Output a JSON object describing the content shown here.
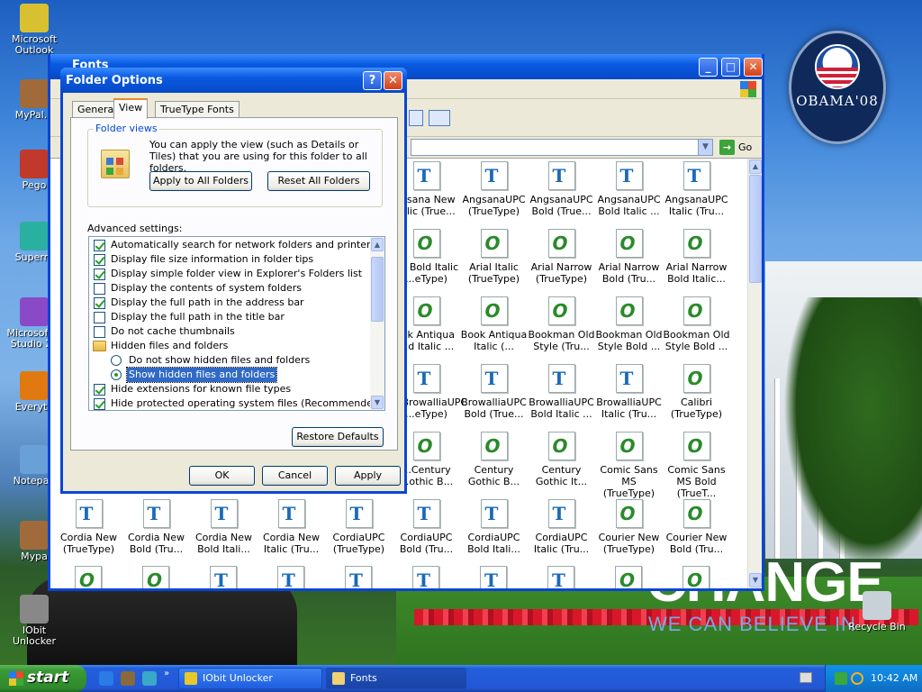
{
  "desktop": {
    "icons": [
      {
        "label": "Microsoft Outlook",
        "color": "#d8c030"
      },
      {
        "label": "MyPal...",
        "color": "#a06a3a"
      },
      {
        "label": "Pego",
        "color": "#c0392b"
      },
      {
        "label": "Superm",
        "color": "#2ab0a0"
      },
      {
        "label": "Microsoft V Studio 20",
        "color": "#8a4ac8"
      },
      {
        "label": "Everyth",
        "color": "#e07a10"
      },
      {
        "label": "Notepad",
        "color": "#6aa0d8"
      },
      {
        "label": "Mypa",
        "color": "#a06a3a"
      },
      {
        "label": "IObit Unlocker",
        "color": "#888888"
      },
      {
        "label": "Recycle Bin",
        "color": "#c8d0d8"
      }
    ],
    "wallpaper": {
      "logo_text": "OBAMA'08",
      "headline": "CHANGE",
      "tagline": "WE CAN BELIEVE IN"
    }
  },
  "fonts_window": {
    "title": "Fonts",
    "go_label": "Go",
    "items": [
      {
        "label": "...sana New ...lic (True...",
        "icon": "tt"
      },
      {
        "label": "AngsanaUPC (TrueType)",
        "icon": "tt"
      },
      {
        "label": "AngsanaUPC Bold (True...",
        "icon": "tt"
      },
      {
        "label": "AngsanaUPC Bold Italic ...",
        "icon": "tt"
      },
      {
        "label": "AngsanaUPC Italic (Tru...",
        "icon": "tt"
      },
      {
        "label": "...l Bold Italic ...eType)",
        "icon": "op"
      },
      {
        "label": "Arial Italic (TrueType)",
        "icon": "op"
      },
      {
        "label": "Arial Narrow (TrueType)",
        "icon": "op"
      },
      {
        "label": "Arial Narrow Bold (Tru...",
        "icon": "op"
      },
      {
        "label": "Arial Narrow Bold Italic...",
        "icon": "op"
      },
      {
        "label": "...k Antiqua ...d Italic ...",
        "icon": "op"
      },
      {
        "label": "Book Antiqua Italic (...",
        "icon": "op"
      },
      {
        "label": "Bookman Old Style (Tru...",
        "icon": "op"
      },
      {
        "label": "Bookman Old Style Bold ...",
        "icon": "op"
      },
      {
        "label": "Bookman Old Style Bold ...",
        "icon": "op"
      },
      {
        "label": "...BrowalliaUPC ...eType)",
        "icon": "tt"
      },
      {
        "label": "BrowalliaUPC Bold (True...",
        "icon": "tt"
      },
      {
        "label": "BrowalliaUPC Bold Italic ...",
        "icon": "tt"
      },
      {
        "label": "BrowalliaUPC Italic (Tru...",
        "icon": "tt"
      },
      {
        "label": "Calibri (TrueType)",
        "icon": "op"
      },
      {
        "label": "...Century ...othic B...",
        "icon": "op"
      },
      {
        "label": "Century Gothic B...",
        "icon": "op"
      },
      {
        "label": "Century Gothic It...",
        "icon": "op"
      },
      {
        "label": "Comic Sans MS (TrueType)",
        "icon": "op"
      },
      {
        "label": "Comic Sans MS Bold (TrueT...",
        "icon": "op"
      }
    ],
    "bottom_row": [
      {
        "label": "Cordia New (TrueType)",
        "icon": "tt"
      },
      {
        "label": "Cordia New Bold (Tru...",
        "icon": "tt"
      },
      {
        "label": "Cordia New Bold Itali...",
        "icon": "tt"
      },
      {
        "label": "Cordia New Italic (Tru...",
        "icon": "tt"
      },
      {
        "label": "CordiaUPC (TrueType)",
        "icon": "tt"
      },
      {
        "label": "CordiaUPC Bold (Tru...",
        "icon": "tt"
      },
      {
        "label": "CordiaUPC Bold Itali...",
        "icon": "tt"
      },
      {
        "label": "CordiaUPC Italic (Tru...",
        "icon": "tt"
      },
      {
        "label": "Courier New (TrueType)",
        "icon": "op"
      },
      {
        "label": "Courier New Bold (Tru...",
        "icon": "op"
      }
    ]
  },
  "dialog": {
    "title": "Folder Options",
    "help_label": "?",
    "close_label": "✕",
    "tabs": [
      {
        "label": "General",
        "active": false
      },
      {
        "label": "View",
        "active": true
      },
      {
        "label": "TrueType Fonts",
        "active": false
      }
    ],
    "folder_views": {
      "label": "Folder views",
      "description": "You can apply the view (such as Details or Tiles) that you are using for this folder to all folders.",
      "apply_all_label": "Apply to All Folders",
      "reset_all_label": "Reset All Folders"
    },
    "advanced_label": "Advanced settings:",
    "settings": [
      {
        "type": "check",
        "checked": true,
        "label": "Automatically search for network folders and printers"
      },
      {
        "type": "check",
        "checked": true,
        "label": "Display file size information in folder tips"
      },
      {
        "type": "check",
        "checked": true,
        "label": "Display simple folder view in Explorer's Folders list"
      },
      {
        "type": "check",
        "checked": false,
        "label": "Display the contents of system folders"
      },
      {
        "type": "check",
        "checked": true,
        "label": "Display the full path in the address bar"
      },
      {
        "type": "check",
        "checked": false,
        "label": "Display the full path in the title bar"
      },
      {
        "type": "check",
        "checked": false,
        "label": "Do not cache thumbnails"
      },
      {
        "type": "folder",
        "checked": false,
        "label": "Hidden files and folders"
      },
      {
        "type": "radio",
        "checked": false,
        "label": "Do not show hidden files and folders"
      },
      {
        "type": "radio",
        "checked": true,
        "label": "Show hidden files and folders"
      },
      {
        "type": "check",
        "checked": true,
        "label": "Hide extensions for known file types"
      },
      {
        "type": "check",
        "checked": true,
        "label": "Hide protected operating system files (Recommended)"
      }
    ],
    "restore_defaults_label": "Restore Defaults",
    "ok_label": "OK",
    "cancel_label": "Cancel",
    "apply_label": "Apply"
  },
  "taskbar": {
    "start_label": "start",
    "tasks": [
      {
        "label": "IObit Unlocker"
      },
      {
        "label": "Fonts"
      }
    ],
    "clock": "10:42 AM"
  }
}
